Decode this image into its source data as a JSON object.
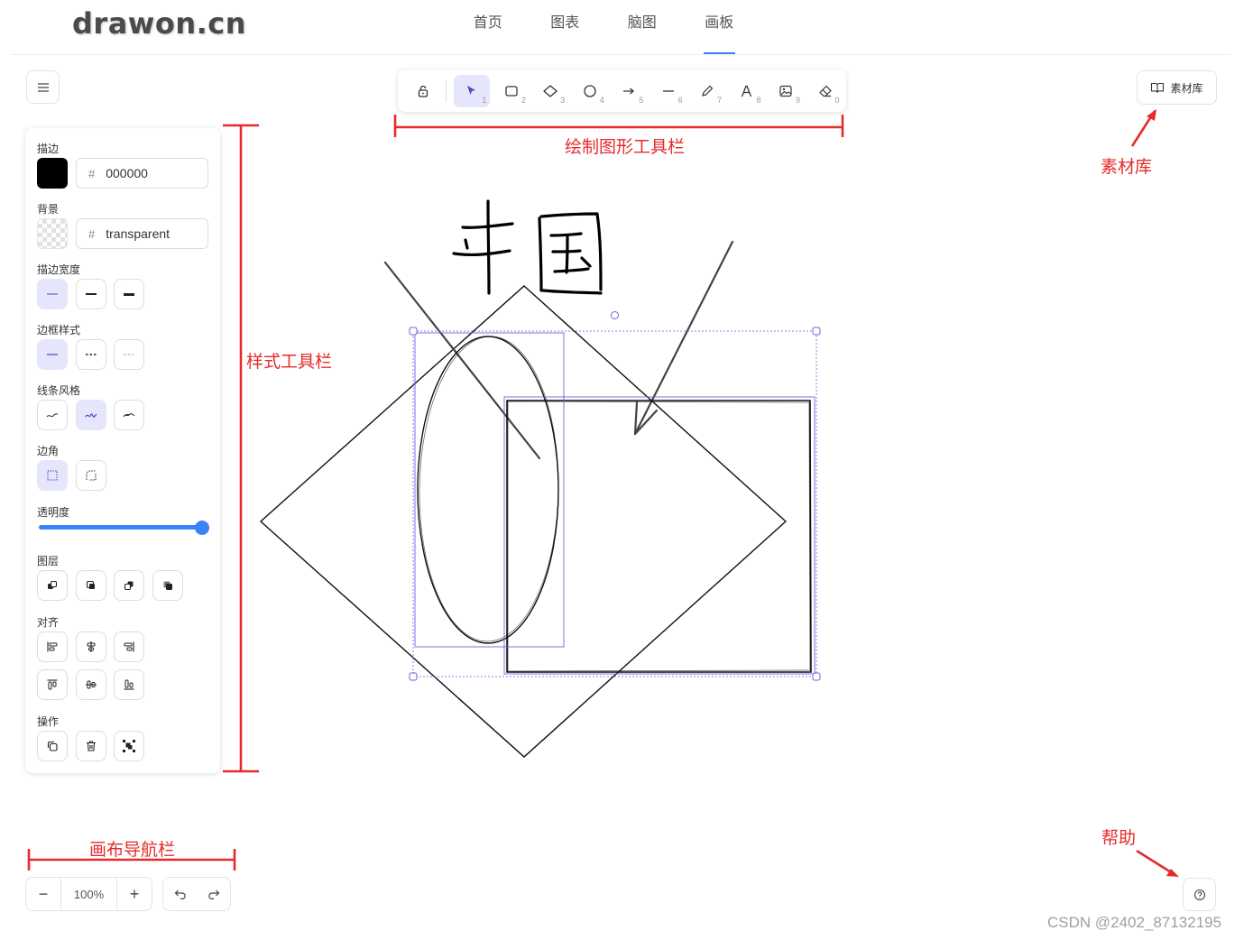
{
  "header": {
    "logo": "drawon.cn",
    "nav": [
      {
        "label": "首页",
        "active": false
      },
      {
        "label": "图表",
        "active": false
      },
      {
        "label": "脑图",
        "active": false
      },
      {
        "label": "画板",
        "active": true
      }
    ]
  },
  "menu_button": {
    "icon": "hamburger-icon"
  },
  "toolbar": {
    "tools": [
      {
        "icon": "lock-icon",
        "num": ""
      },
      {
        "icon": "pointer-icon",
        "num": "1",
        "active": true
      },
      {
        "icon": "rectangle-icon",
        "num": "2"
      },
      {
        "icon": "diamond-icon",
        "num": "3"
      },
      {
        "icon": "ellipse-icon",
        "num": "4"
      },
      {
        "icon": "arrow-icon",
        "num": "5"
      },
      {
        "icon": "line-icon",
        "num": "6"
      },
      {
        "icon": "pencil-icon",
        "num": "7"
      },
      {
        "icon": "text-icon",
        "num": "8"
      },
      {
        "icon": "image-icon",
        "num": "9"
      },
      {
        "icon": "eraser-icon",
        "num": "0"
      }
    ]
  },
  "library_button": {
    "label": "素材库",
    "icon": "book-icon"
  },
  "style_panel": {
    "stroke": {
      "label": "描边",
      "value": "000000",
      "color": "#000000"
    },
    "background": {
      "label": "背景",
      "value": "transparent"
    },
    "stroke_width": {
      "label": "描边宽度",
      "options": [
        "thin",
        "medium",
        "bold"
      ],
      "selected": 0
    },
    "stroke_style": {
      "label": "边框样式",
      "options": [
        "solid",
        "dashed",
        "dotted"
      ],
      "selected": 0
    },
    "sloppiness": {
      "label": "线条风格",
      "options": [
        "architect",
        "artist",
        "cartoonist"
      ],
      "selected": 1
    },
    "edges": {
      "label": "边角",
      "options": [
        "sharp",
        "round"
      ],
      "selected": 0
    },
    "opacity": {
      "label": "透明度",
      "value": 100
    },
    "layers": {
      "label": "图层",
      "buttons": [
        "send-to-back-icon",
        "send-backward-icon",
        "bring-forward-icon",
        "bring-to-front-icon"
      ]
    },
    "align": {
      "label": "对齐",
      "buttons": [
        "align-left-icon",
        "align-center-h-icon",
        "align-right-icon",
        "align-top-icon",
        "align-center-v-icon",
        "align-bottom-icon"
      ]
    },
    "actions": {
      "label": "操作",
      "buttons": [
        "duplicate-icon",
        "delete-icon",
        "group-icon"
      ]
    }
  },
  "zoom": {
    "minus": "−",
    "value": "100%",
    "plus": "+"
  },
  "history": {
    "undo_icon": "undo-icon",
    "redo_icon": "redo-icon"
  },
  "help": {
    "icon": "help-icon"
  },
  "annotations": {
    "toolbar": "绘制图形工具栏",
    "library": "素材库",
    "style": "样式工具栏",
    "nav": "画布导航栏",
    "help": "帮助",
    "color": "#e52b2b"
  },
  "watermark": "CSDN @2402_87132195",
  "accent_color": "#3b82f6",
  "selection_color": "#6965db"
}
